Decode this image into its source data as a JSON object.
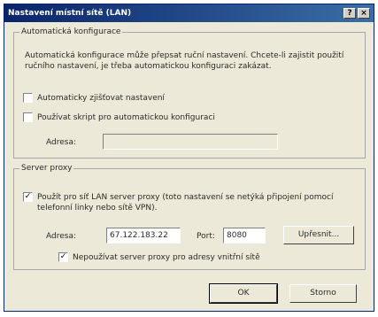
{
  "window": {
    "title": "Nastavení místní sítě (LAN)",
    "help_btn": "?",
    "close_btn": "×"
  },
  "auto_config": {
    "legend": "Automatická konfigurace",
    "description": "Automatická konfigurace může přepsat ruční nastavení. Chcete-li zajistit použití ručního nastavení, je třeba automatickou konfiguraci zakázat.",
    "auto_detect": {
      "label": "Automaticky zjišťovat nastavení",
      "checked": false
    },
    "use_script": {
      "label": "Používat skript pro automatickou konfiguraci",
      "checked": false
    },
    "address_label": "Adresa:",
    "address_value": ""
  },
  "proxy": {
    "legend": "Server proxy",
    "use_proxy": {
      "label": "Použít pro síť LAN server proxy (toto nastavení se netýká připojení pomocí telefonní linky nebo sítě VPN).",
      "checked": true
    },
    "address_label": "Adresa:",
    "address_value": "67.122.183.22",
    "port_label": "Port:",
    "port_value": "8080",
    "advanced_btn": "Upřesnit...",
    "bypass_local": {
      "label": "Nepoužívat server proxy pro adresy vnitřní sítě",
      "checked": true
    }
  },
  "buttons": {
    "ok": "OK",
    "cancel": "Storno"
  }
}
